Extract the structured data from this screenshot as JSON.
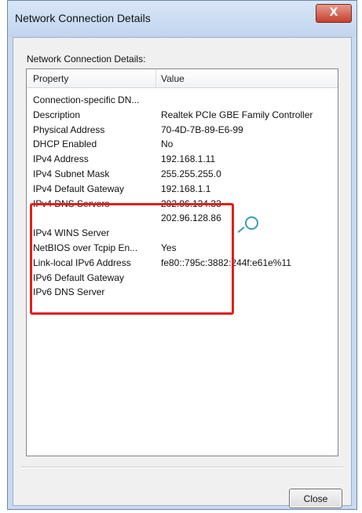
{
  "window": {
    "title": "Network Connection Details",
    "close_glyph": "X"
  },
  "dialog": {
    "section_label": "Network Connection Details:",
    "columns": {
      "property": "Property",
      "value": "Value"
    },
    "rows": [
      {
        "property": "Connection-specific DN...",
        "value": ""
      },
      {
        "property": "Description",
        "value": "Realtek PCIe GBE Family Controller"
      },
      {
        "property": "Physical Address",
        "value": "70-4D-7B-89-E6-99"
      },
      {
        "property": "DHCP Enabled",
        "value": "No"
      },
      {
        "property": "IPv4 Address",
        "value": "192.168.1.11"
      },
      {
        "property": "IPv4 Subnet Mask",
        "value": "255.255.255.0"
      },
      {
        "property": "IPv4 Default Gateway",
        "value": "192.168.1.1"
      },
      {
        "property": "IPv4 DNS Servers",
        "value": "202.96.134.33"
      },
      {
        "property": "",
        "value": "202.96.128.86"
      },
      {
        "property": "IPv4 WINS Server",
        "value": ""
      },
      {
        "property": "NetBIOS over Tcpip En...",
        "value": "Yes"
      },
      {
        "property": "Link-local IPv6 Address",
        "value": "fe80::795c:3882:244f:e61e%11"
      },
      {
        "property": "IPv6 Default Gateway",
        "value": ""
      },
      {
        "property": "IPv6 DNS Server",
        "value": ""
      }
    ],
    "close_label": "Close"
  },
  "colors": {
    "highlight_box": "#e0201c",
    "cursor": "#3a9fb2"
  }
}
